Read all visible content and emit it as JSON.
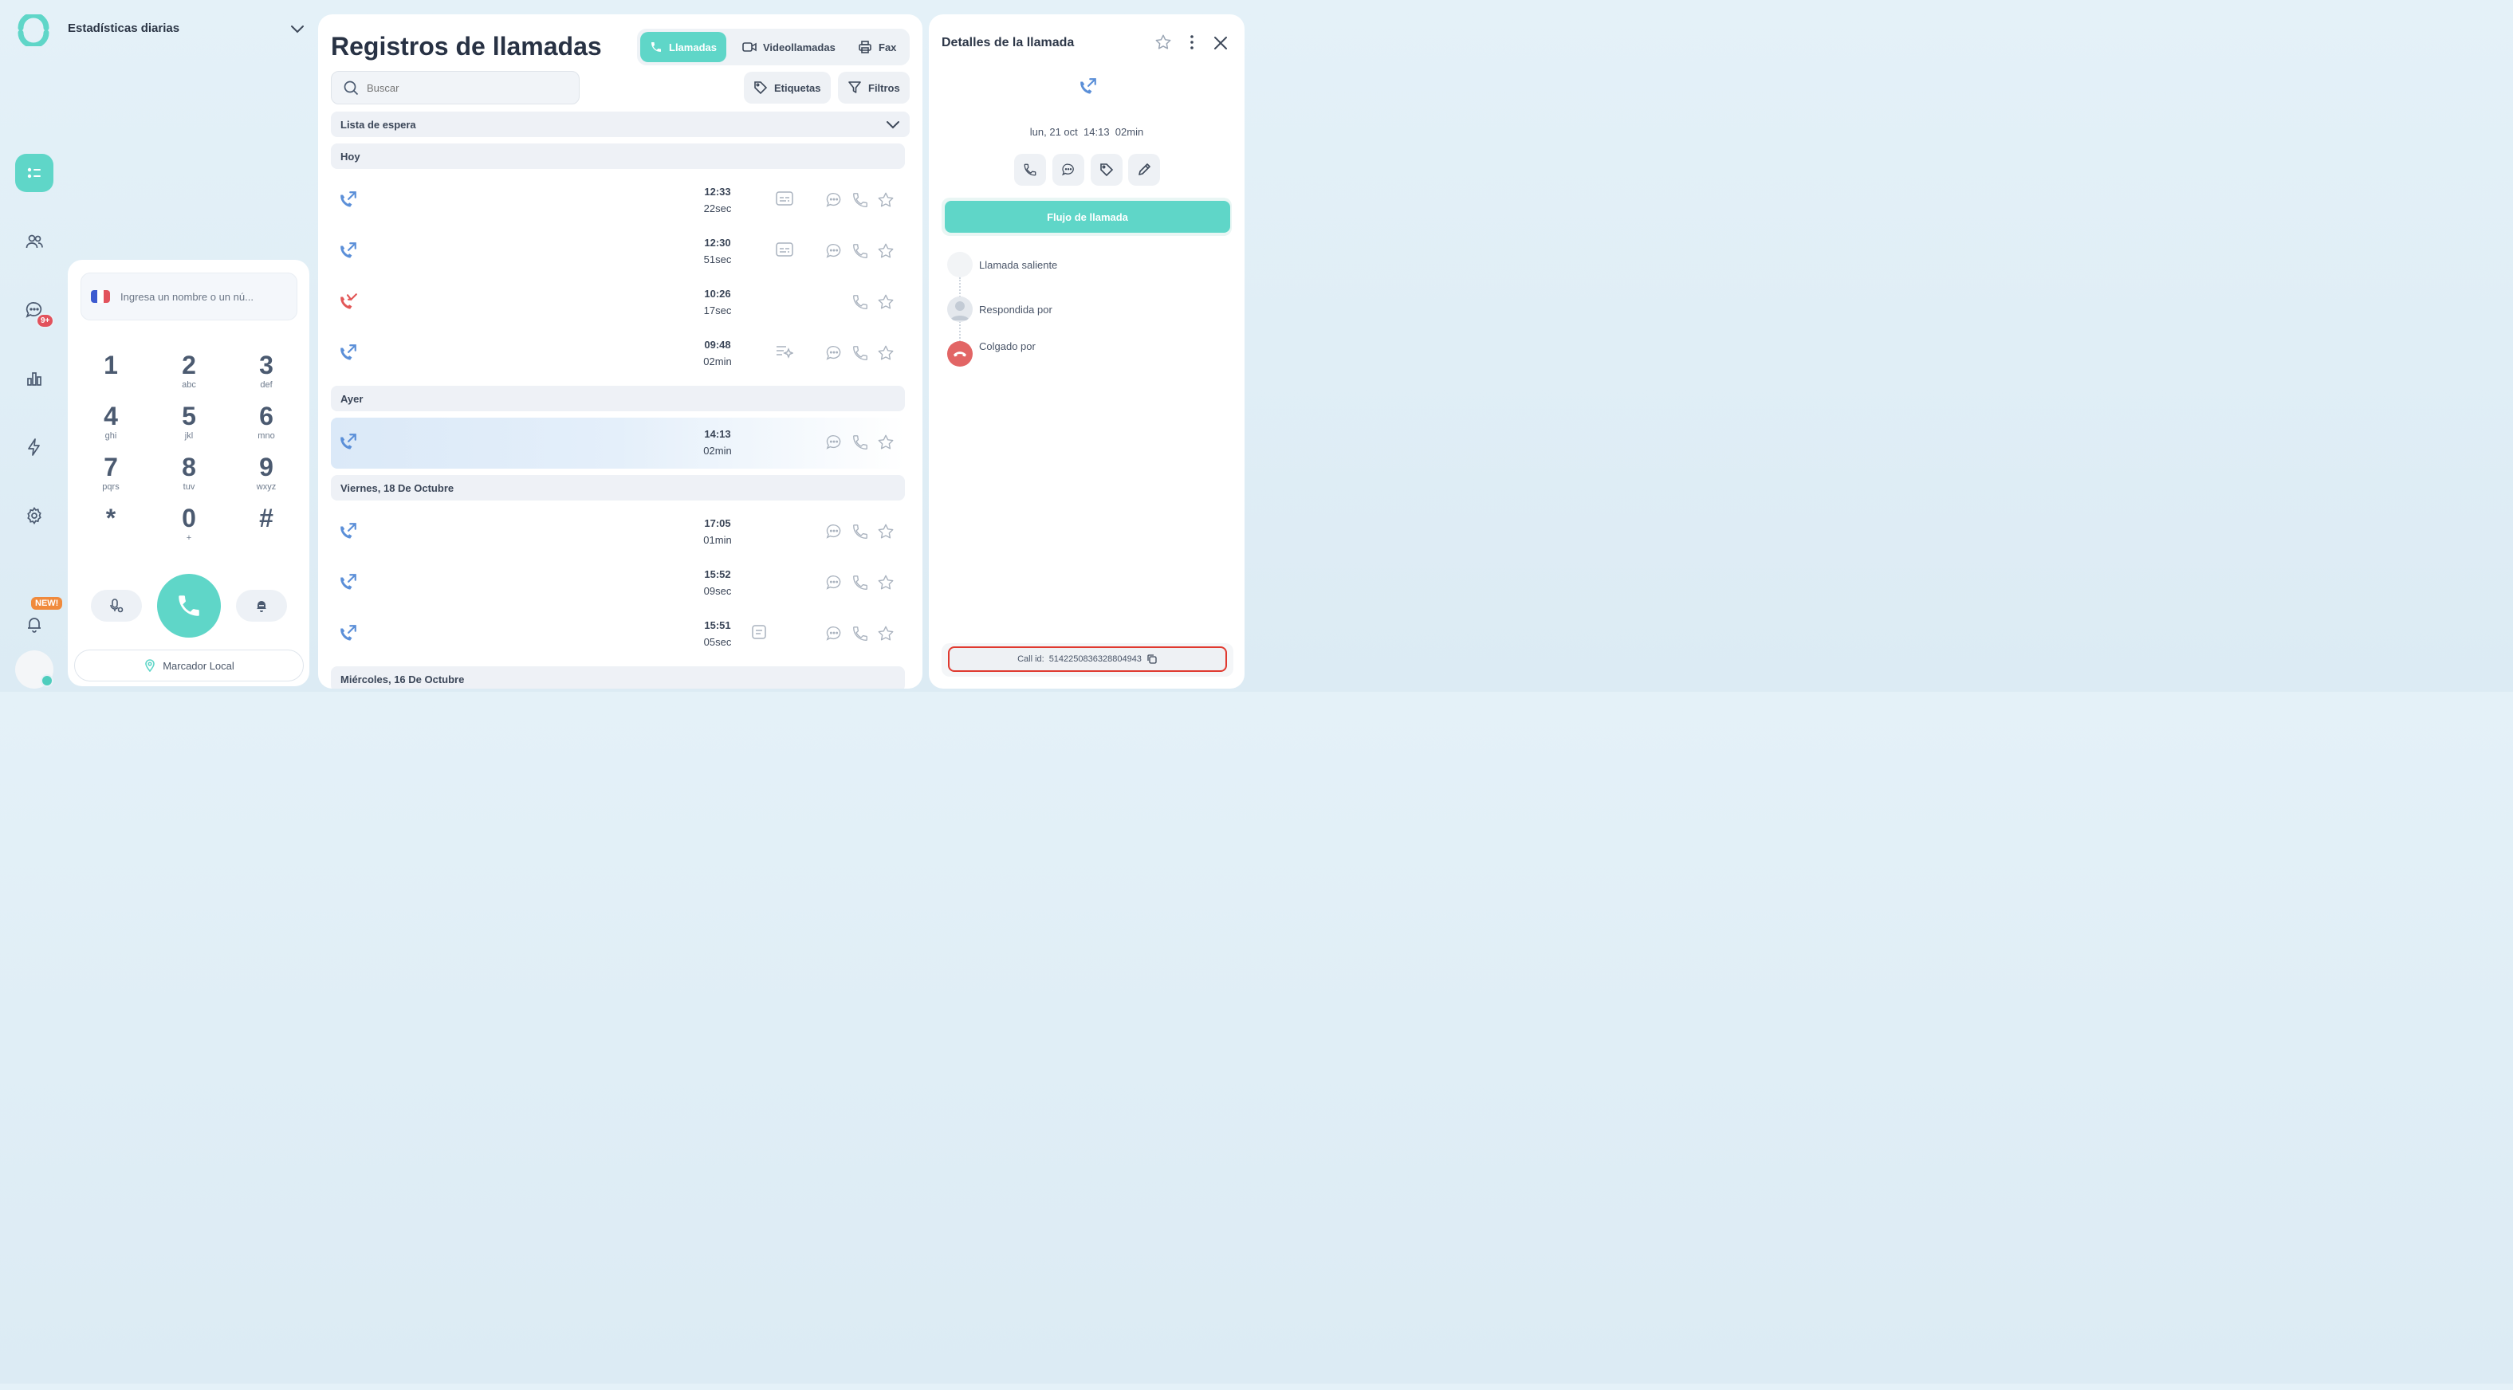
{
  "sidebar": {
    "title": "Estadísticas diarias",
    "messages_badge": "9+",
    "new_badge": "NEW!"
  },
  "dialer": {
    "placeholder": "Ingresa un nombre o un nú...",
    "keys": [
      {
        "digit": "1",
        "letters": ""
      },
      {
        "digit": "2",
        "letters": "abc"
      },
      {
        "digit": "3",
        "letters": "def"
      },
      {
        "digit": "4",
        "letters": "ghi"
      },
      {
        "digit": "5",
        "letters": "jkl"
      },
      {
        "digit": "6",
        "letters": "mno"
      },
      {
        "digit": "7",
        "letters": "pqrs"
      },
      {
        "digit": "8",
        "letters": "tuv"
      },
      {
        "digit": "9",
        "letters": "wxyz"
      },
      {
        "digit": "*",
        "letters": ""
      },
      {
        "digit": "0",
        "letters": "+"
      },
      {
        "digit": "#",
        "letters": ""
      }
    ],
    "local_dialer": "Marcador Local"
  },
  "call_log": {
    "title": "Registros de llamadas",
    "tabs": [
      "Llamadas",
      "Videollamadas",
      "Fax"
    ],
    "search_placeholder": "Buscar",
    "tags_button": "Etiquetas",
    "filters_button": "Filtros",
    "waitlist": "Lista de espera",
    "sections": [
      {
        "label": "Hoy",
        "rows": [
          {
            "time": "12:33",
            "duration": "22sec",
            "direction": "outgoing",
            "extra": "transcript",
            "message": true
          },
          {
            "time": "12:30",
            "duration": "51sec",
            "direction": "outgoing",
            "extra": "transcript",
            "message": true
          },
          {
            "time": "10:26",
            "duration": "17sec",
            "direction": "missed",
            "extra": "",
            "message": false
          },
          {
            "time": "09:48",
            "duration": "02min",
            "direction": "outgoing",
            "extra": "summary",
            "message": true
          }
        ]
      },
      {
        "label": "Ayer",
        "rows": [
          {
            "time": "14:13",
            "duration": "02min",
            "direction": "outgoing",
            "extra": "",
            "message": true,
            "selected": true
          }
        ]
      },
      {
        "label": "Viernes, 18 De Octubre",
        "rows": [
          {
            "time": "17:05",
            "duration": "01min",
            "direction": "outgoing",
            "extra": "",
            "message": true
          },
          {
            "time": "15:52",
            "duration": "09sec",
            "direction": "outgoing",
            "extra": "",
            "message": true
          },
          {
            "time": "15:51",
            "duration": "05sec",
            "direction": "outgoing",
            "extra": "note",
            "message": true
          }
        ]
      },
      {
        "label": "Miércoles, 16 De Octubre",
        "rows": []
      }
    ]
  },
  "details": {
    "title": "Detalles de la llamada",
    "date": "lun, 21 oct",
    "time": "14:13",
    "duration": "02min",
    "flow_button": "Flujo de llamada",
    "timeline": [
      "Llamada saliente",
      "Respondida por",
      "Colgado por"
    ],
    "call_id_label": "Call id:",
    "call_id": "5142250836328804943"
  },
  "colors": {
    "accent": "#5fd6c8",
    "outgoing": "#5b8fd8",
    "missed": "#e25757",
    "highlight": "#e0392f"
  }
}
